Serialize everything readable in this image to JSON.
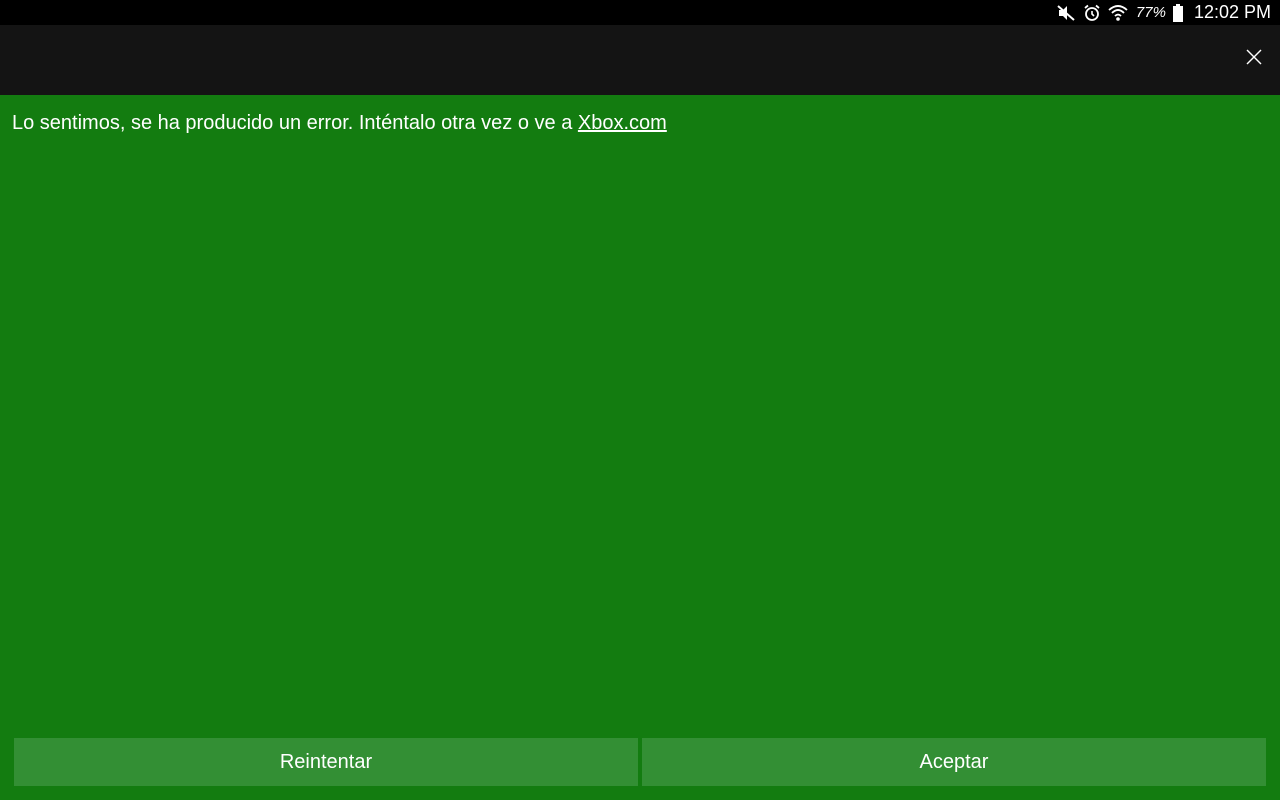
{
  "status_bar": {
    "icons": [
      "mute-icon",
      "alarm-icon",
      "wifi-icon",
      "battery-icon"
    ],
    "battery_percent": "77%",
    "time": "12:02 PM"
  },
  "title_bar": {
    "close_icon": "close-icon"
  },
  "content": {
    "message_text": "Lo sentimos, se ha producido un error. Inténtalo otra vez o ve a ",
    "link_text": "Xbox.com"
  },
  "buttons": {
    "retry_label": "Reintentar",
    "accept_label": "Aceptar"
  },
  "colors": {
    "background_green": "#137c10",
    "button_green": "#338f34",
    "title_bar": "#141414",
    "status_bar": "#000000"
  }
}
